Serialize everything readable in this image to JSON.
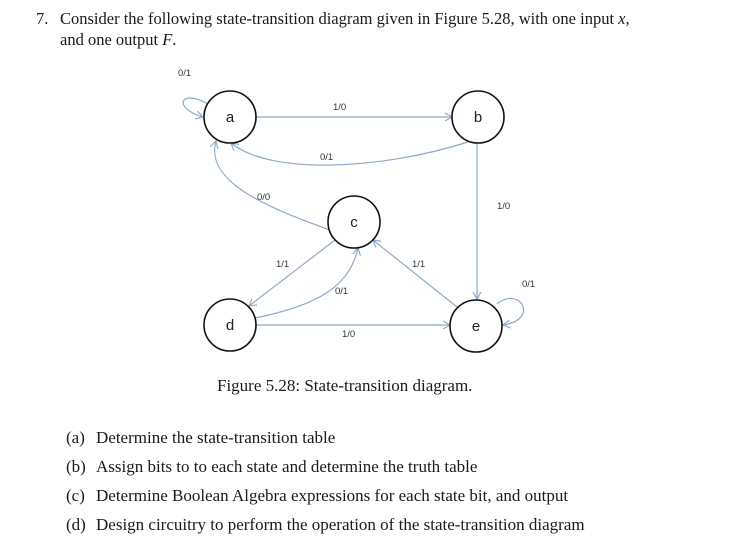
{
  "question": {
    "number": "7.",
    "line1_prefix": "Consider the following state-transition diagram given in Figure 5.28, with one input ",
    "input_var": "x",
    "line1_suffix": ",",
    "line2_prefix": "and one output ",
    "output_var": "F",
    "line2_suffix": "."
  },
  "diagram": {
    "states": [
      "a",
      "b",
      "c",
      "d",
      "e"
    ],
    "transitions": [
      {
        "from": "a",
        "to": "a",
        "label": "0/1"
      },
      {
        "from": "a",
        "to": "b",
        "label": "1/0"
      },
      {
        "from": "b",
        "to": "a",
        "label": "0/1"
      },
      {
        "from": "b",
        "to": "e",
        "label": "1/0"
      },
      {
        "from": "c",
        "to": "a",
        "label": "0/0"
      },
      {
        "from": "c",
        "to": "d",
        "label": "1/1"
      },
      {
        "from": "d",
        "to": "c",
        "label": "0/1"
      },
      {
        "from": "d",
        "to": "e",
        "label": "1/0"
      },
      {
        "from": "e",
        "to": "c",
        "label": "1/1"
      },
      {
        "from": "e",
        "to": "e",
        "label": "0/1"
      }
    ],
    "colors": {
      "edge": "#8fa9c8",
      "node_stroke": "#111111"
    }
  },
  "caption": "Figure 5.28: State-transition diagram.",
  "parts": [
    {
      "label": "(a)",
      "text": "Determine the state-transition table"
    },
    {
      "label": "(b)",
      "text": "Assign bits to to each state and determine the truth table"
    },
    {
      "label": "(c)",
      "text": "Determine Boolean Algebra expressions for each state bit, and output"
    },
    {
      "label": "(d)",
      "text": "Design circuitry to perform the operation of the state-transition diagram"
    }
  ]
}
